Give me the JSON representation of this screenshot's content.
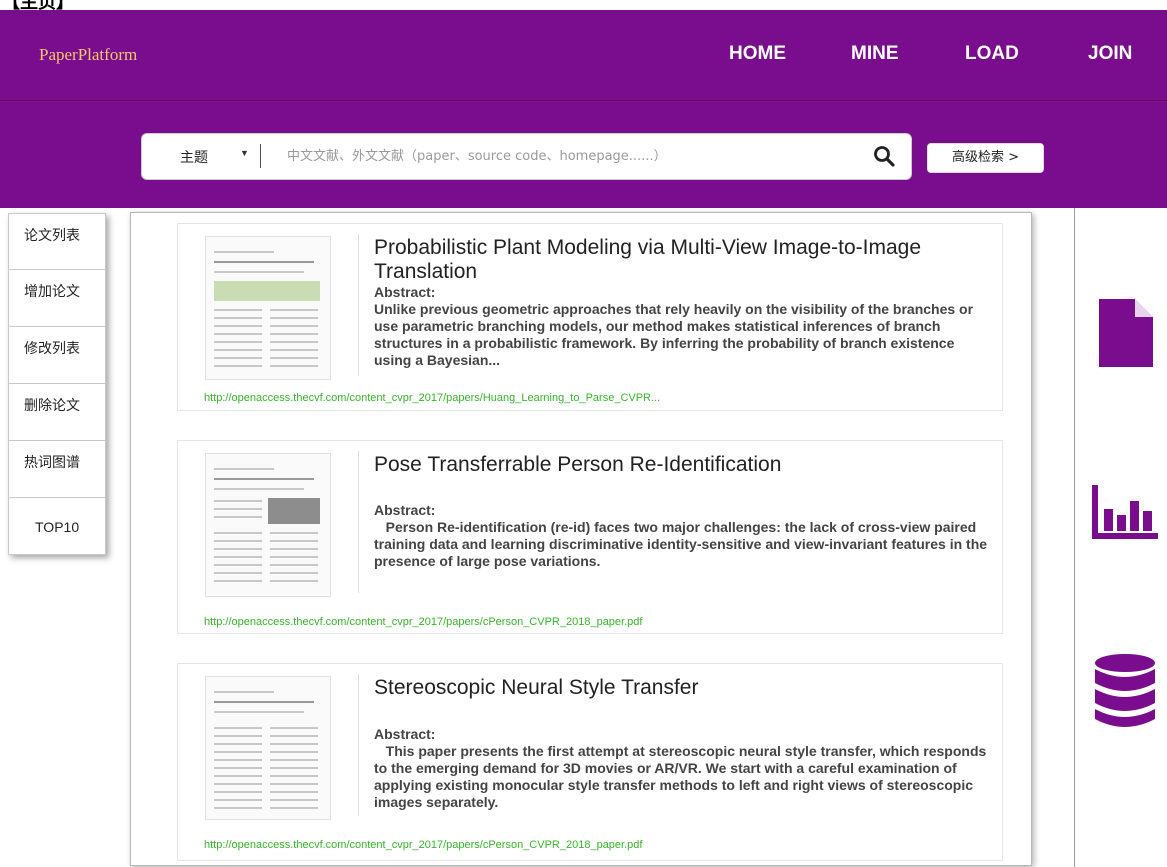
{
  "page_caption": "【主页】",
  "nav": {
    "logo": "PaperPlatform",
    "links": [
      "HOME",
      "MINE",
      "LOAD",
      "JOIN"
    ]
  },
  "search": {
    "type_label": "主题",
    "placeholder": "中文文献、外文文献（paper、source code、homepage......）",
    "advanced_label": "高级检索 >"
  },
  "sidebar": {
    "items": [
      "论文列表",
      "增加论文",
      "修改列表",
      "删除论文",
      "热词图谱",
      "TOP10"
    ]
  },
  "papers": [
    {
      "title": "Probabilistic Plant Modeling via Multi-View Image-to-Image Translation",
      "abstract_label": "Abstract:",
      "abstract": "Unlike previous geometric approaches that rely heavily on the visibility of the branches or use parametric branching models, our method makes statistical inferences of branch structures in a probabilistic framework. By inferring the probability of branch existence using a Bayesian...",
      "url": "http://openaccess.thecvf.com/content_cvpr_2017/papers/Huang_Learning_to_Parse_CVPR..."
    },
    {
      "title": "Pose Transferrable Person Re-Identification",
      "abstract_label": "Abstract:",
      "abstract": "   Person Re-identification (re-id) faces two major challenges: the lack of cross-view paired training data and learning discriminative identity-sensitive and view-invariant features in the presence of large pose variations.",
      "url": "http://openaccess.thecvf.com/content_cvpr_2017/papers/cPerson_CVPR_2018_paper.pdf"
    },
    {
      "title": "Stereoscopic Neural Style Transfer",
      "abstract_label": "Abstract:",
      "abstract": "   This paper presents the first attempt at stereoscopic neural style transfer, which responds to the emerging demand for 3D movies or AR/VR. We start with a careful examination of applying existing monocular style transfer methods to left and right views of stereoscopic images separately.",
      "url": "http://openaccess.thecvf.com/content_cvpr_2017/papers/cPerson_CVPR_2018_paper.pdf"
    }
  ],
  "right_icons": [
    "document-icon",
    "bar-chart-icon",
    "database-icon"
  ],
  "colors": {
    "brand_purple": "#7a0d8e",
    "logo_gold": "#f4c86a",
    "url_green": "#35b52a"
  }
}
